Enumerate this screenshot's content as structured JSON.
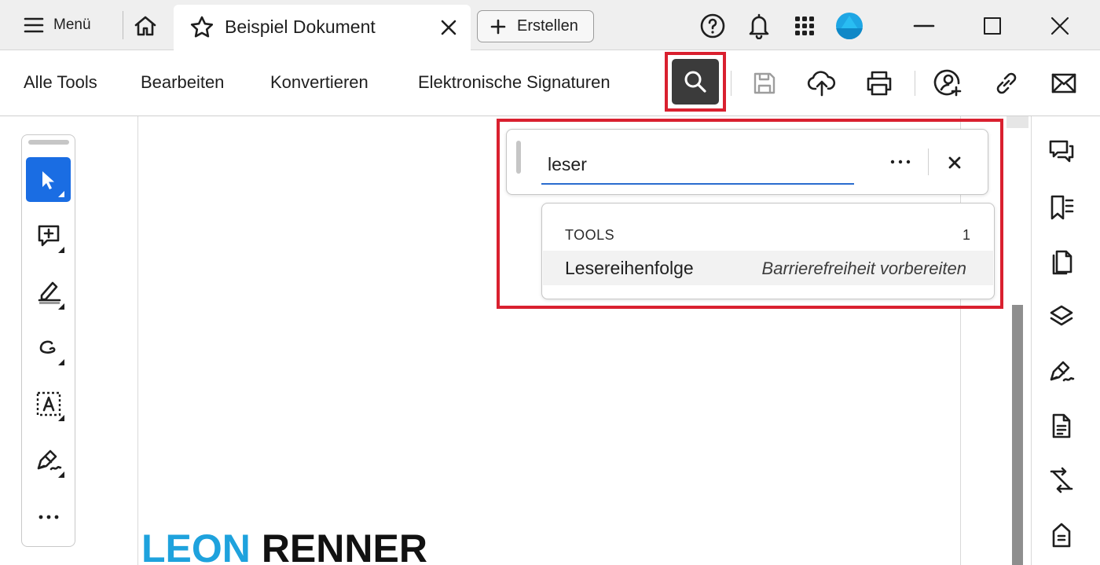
{
  "titlebar": {
    "menu_label": "Menü",
    "tab_title": "Beispiel Dokument",
    "create_label": "Erstellen",
    "help_icon": "help-circle-icon",
    "bell_icon": "bell-icon",
    "apps_icon": "apps-grid-icon",
    "avatar_color": "#1ea6e4"
  },
  "toolbar": {
    "nav": [
      "Alle Tools",
      "Bearbeiten",
      "Konvertieren",
      "Elektronische Signaturen"
    ],
    "icons": [
      "search-icon",
      "save-icon",
      "cloud-upload-icon",
      "print-icon",
      "share-user-icon",
      "link-icon",
      "mail-icon"
    ]
  },
  "left_tools": [
    "select-cursor-icon",
    "add-comment-icon",
    "highlight-pen-icon",
    "freehand-draw-icon",
    "text-box-icon",
    "sign-pen-icon",
    "more-dots-icon"
  ],
  "search": {
    "value": "leser",
    "results_header": "TOOLS",
    "results_count": "1",
    "results": [
      {
        "name": "Lesereihenfolge",
        "category": "Barrierefreiheit vorbereiten"
      }
    ]
  },
  "right_panel": [
    "comments-icon",
    "bookmark-icon",
    "pages-icon",
    "layers-icon",
    "sign-icon",
    "document-icon",
    "compare-icon",
    "attachment-icon"
  ],
  "brand": {
    "first": "LEON",
    "last": "RENNER"
  },
  "colors": {
    "accent": "#1a6de3",
    "highlight": "#d9202f",
    "brand_blue": "#1ea2dd"
  }
}
